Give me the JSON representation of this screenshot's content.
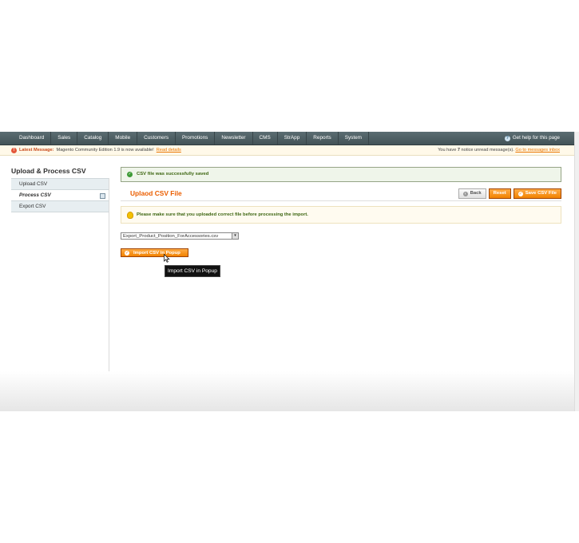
{
  "nav": {
    "items": [
      "Dashboard",
      "Sales",
      "Catalog",
      "Mobile",
      "Customers",
      "Promotions",
      "Newsletter",
      "CMS",
      "StrApp",
      "Reports",
      "System"
    ],
    "help": "Get help for this page"
  },
  "notice": {
    "label": "Latest Message:",
    "message": "Magento Community Edition 1.9 is now available!",
    "read_link": "Read details",
    "right_pre": "You have ",
    "count": "7",
    "right_post": " notice unread message(s). ",
    "inbox_link": "Go to messages inbox"
  },
  "sidebar": {
    "title": "Upload & Process CSV",
    "items": [
      {
        "label": "Upload CSV"
      },
      {
        "label": "Process CSV"
      },
      {
        "label": "Export CSV"
      }
    ]
  },
  "success": {
    "text": "CSV file was successfully saved"
  },
  "header": {
    "title": "Uplaod CSV File",
    "back_label": "Back",
    "reset_label": "Reset",
    "save_label": "Save CSV File"
  },
  "warning": {
    "text": "Please make sure that you uploaded correct file before processing the import."
  },
  "file_select": {
    "selected": "Export_Product_Position_ForAccessories.csv"
  },
  "import_button": {
    "label": "Import CSV in Popup"
  },
  "tooltip": {
    "text": "Import CSV in Popup"
  },
  "colors": {
    "accent": "#eb5e00",
    "nav": "#4d5f64",
    "success": "#3d6611"
  }
}
